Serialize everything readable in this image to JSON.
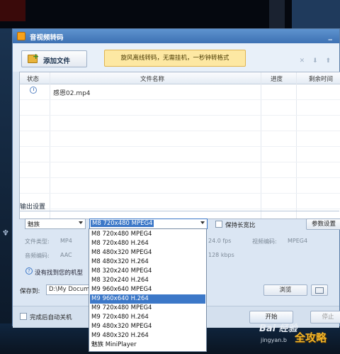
{
  "window": {
    "title": "音视频转码",
    "minimize": "_"
  },
  "toolbar": {
    "add_file": "添加文件",
    "promo": "旋风离线转码，无需挂机，一秒钟转格式",
    "icons": "✕ ⬇ ⬆"
  },
  "table": {
    "headers": [
      "状态",
      "文件名称",
      "进度",
      "剩余时间"
    ],
    "rows": [
      {
        "filename": "感恩02.mp4",
        "progress": "",
        "remaining": ""
      }
    ]
  },
  "output": {
    "section_label": "输出设置",
    "device": "魅族",
    "format_selected": "M8 720x480 MPEG4",
    "keep_ratio_label": "保持长宽比",
    "params_button": "参数设置",
    "file_type_label": "文件类型:",
    "file_type_value": "MP4",
    "audio_codec_label": "音频编码:",
    "audio_codec_value": "AAC",
    "fps_value": "24.0 fps",
    "bitrate_value": "128 kbps",
    "video_codec_label": "视频编码:",
    "video_codec_value": "MPEG4",
    "help_text": "没有找到您的机型"
  },
  "save": {
    "label": "保存到:",
    "path": "D:\\My Docum",
    "browse": "浏览"
  },
  "bottom": {
    "auto_shutdown": "完成后自动关机",
    "start": "开始",
    "stop": "停止"
  },
  "dropdown_options": [
    "M8 720x480 MPEG4",
    "M8 720x480 H.264",
    "M8 480x320 MPEG4",
    "M8 480x320 H.264",
    "M8 320x240 MPEG4",
    "M8 320x240 H.264",
    "M9 960x640 MPEG4",
    "M9 960x640 H.264",
    "M9 720x480 MPEG4",
    "M9 720x480 H.264",
    "M9 480x320 MPEG4",
    "M9 480x320 H.264",
    "魅族 MiniPlayer"
  ],
  "dropdown_selected_index": 7,
  "watermark": {
    "brand": "Bai 经验",
    "url": "jingyan.b",
    "corner": "全攻略"
  }
}
